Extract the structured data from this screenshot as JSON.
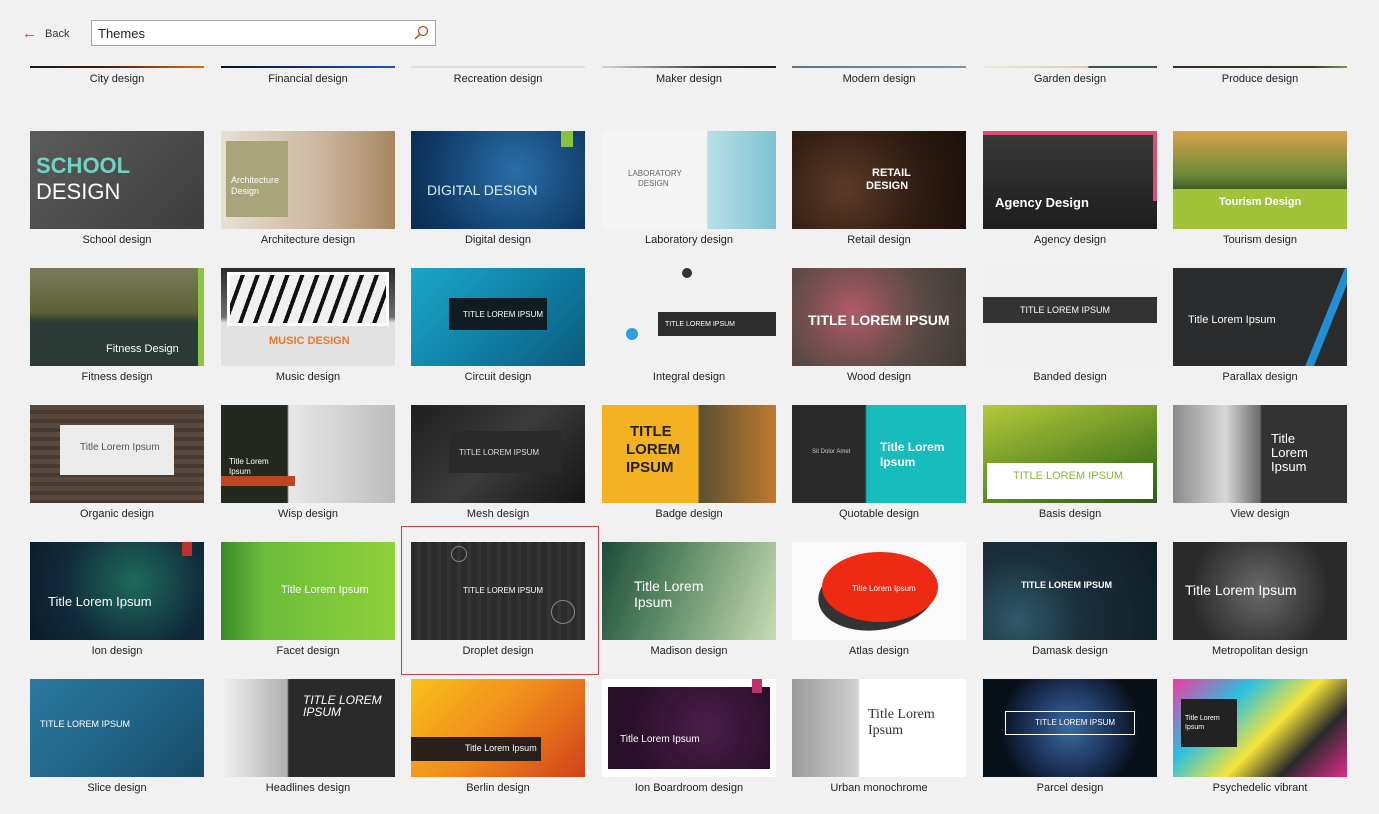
{
  "nav": {
    "back_label": "Back"
  },
  "search": {
    "value": "Themes"
  },
  "thumb_texts": {
    "school": [
      "SCHOOL",
      "DESIGN"
    ],
    "architecture": [
      "Architecture",
      "Design"
    ],
    "digital": "DIGITAL DESIGN",
    "laboratory": [
      "LABORATORY",
      "DESIGN"
    ],
    "retail": [
      "RETAIL",
      "DESIGN"
    ],
    "agency": "Agency Design",
    "tourism": "Tourism Design",
    "fitness": "Fitness Design",
    "music": "MUSIC DESIGN",
    "title_upper": "TITLE LOREM IPSUM",
    "title_mixed": "Title Lorem Ipsum",
    "title_lines": [
      "Title",
      "Lorem",
      "Ipsum"
    ],
    "title_lorem": "Title Lorem",
    "ipsum": "Ipsum",
    "badge_lines": [
      "TITLE",
      "LOREM",
      "IPSUM"
    ],
    "headlines": [
      "TITLE LOREM",
      "IPSUM"
    ],
    "sit_dolor_amet": "Sit Dolor Amet"
  },
  "themes": [
    {
      "label": "City design"
    },
    {
      "label": "Financial design"
    },
    {
      "label": "Recreation design"
    },
    {
      "label": "Maker design"
    },
    {
      "label": "Modern design"
    },
    {
      "label": "Garden design"
    },
    {
      "label": "Produce design"
    },
    {
      "label": "School design"
    },
    {
      "label": "Architecture design"
    },
    {
      "label": "Digital design"
    },
    {
      "label": "Laboratory design"
    },
    {
      "label": "Retail design"
    },
    {
      "label": "Agency design"
    },
    {
      "label": "Tourism design"
    },
    {
      "label": "Fitness design"
    },
    {
      "label": "Music design"
    },
    {
      "label": "Circuit design"
    },
    {
      "label": "Integral design"
    },
    {
      "label": "Wood design"
    },
    {
      "label": "Banded design"
    },
    {
      "label": "Parallax design"
    },
    {
      "label": "Organic design"
    },
    {
      "label": "Wisp design"
    },
    {
      "label": "Mesh design"
    },
    {
      "label": "Badge design"
    },
    {
      "label": "Quotable design"
    },
    {
      "label": "Basis design"
    },
    {
      "label": "View design"
    },
    {
      "label": "Ion design"
    },
    {
      "label": "Facet design"
    },
    {
      "label": "Droplet design",
      "selected": true
    },
    {
      "label": "Madison design"
    },
    {
      "label": "Atlas design"
    },
    {
      "label": "Damask design"
    },
    {
      "label": "Metropolitan design"
    },
    {
      "label": "Slice design"
    },
    {
      "label": "Headlines design"
    },
    {
      "label": "Berlin design"
    },
    {
      "label": "Ion Boardroom design"
    },
    {
      "label": "Urban monochrome"
    },
    {
      "label": "Parcel design"
    },
    {
      "label": "Psychedelic vibrant"
    }
  ],
  "colors": {
    "accent": "#c43e1c",
    "selection_border": "#c4424b"
  }
}
